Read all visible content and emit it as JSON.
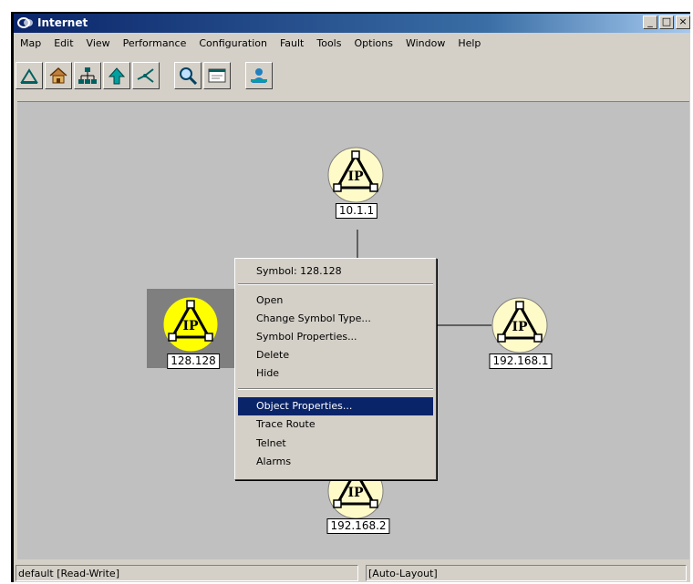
{
  "window": {
    "title": "Internet",
    "controls": [
      "_",
      "□",
      "×"
    ]
  },
  "menubar": [
    "Map",
    "Edit",
    "View",
    "Performance",
    "Configuration",
    "Fault",
    "Tools",
    "Options",
    "Window",
    "Help"
  ],
  "toolbar": {
    "icons": [
      "triangle-icon",
      "home-icon",
      "parent-tree-icon",
      "up-arrow-icon",
      "submap-icon",
      "find-icon",
      "object-browser-icon",
      "network-users-icon"
    ]
  },
  "nodes": [
    {
      "name": "node-10-1-1",
      "label": "10.1.1",
      "icon_text": "IP",
      "selected": false
    },
    {
      "name": "node-128-128",
      "label": "128.128",
      "icon_text": "IP",
      "selected": true
    },
    {
      "name": "node-192-168-1",
      "label": "192.168.1",
      "icon_text": "IP",
      "selected": false
    },
    {
      "name": "node-192-168-2",
      "label": "192.168.2",
      "icon_text": "IP",
      "selected": false
    }
  ],
  "context_menu": {
    "header": "Symbol: 128.128",
    "group1": [
      "Open",
      "Change Symbol Type...",
      "Symbol Properties...",
      "Delete",
      "Hide"
    ],
    "group2": [
      "Object Properties...",
      "Trace Route",
      "Telnet",
      "Alarms"
    ],
    "highlighted": "Object Properties..."
  },
  "statusbar": {
    "mode": "default [Read-Write]",
    "layout": "[Auto-Layout]"
  },
  "colors": {
    "titlebar": "#0a246a",
    "canvas": "#c0c0c0",
    "node_fill": "#fffbc8",
    "node_selected_fill": "#ffff00",
    "highlight": "#0a246a"
  }
}
